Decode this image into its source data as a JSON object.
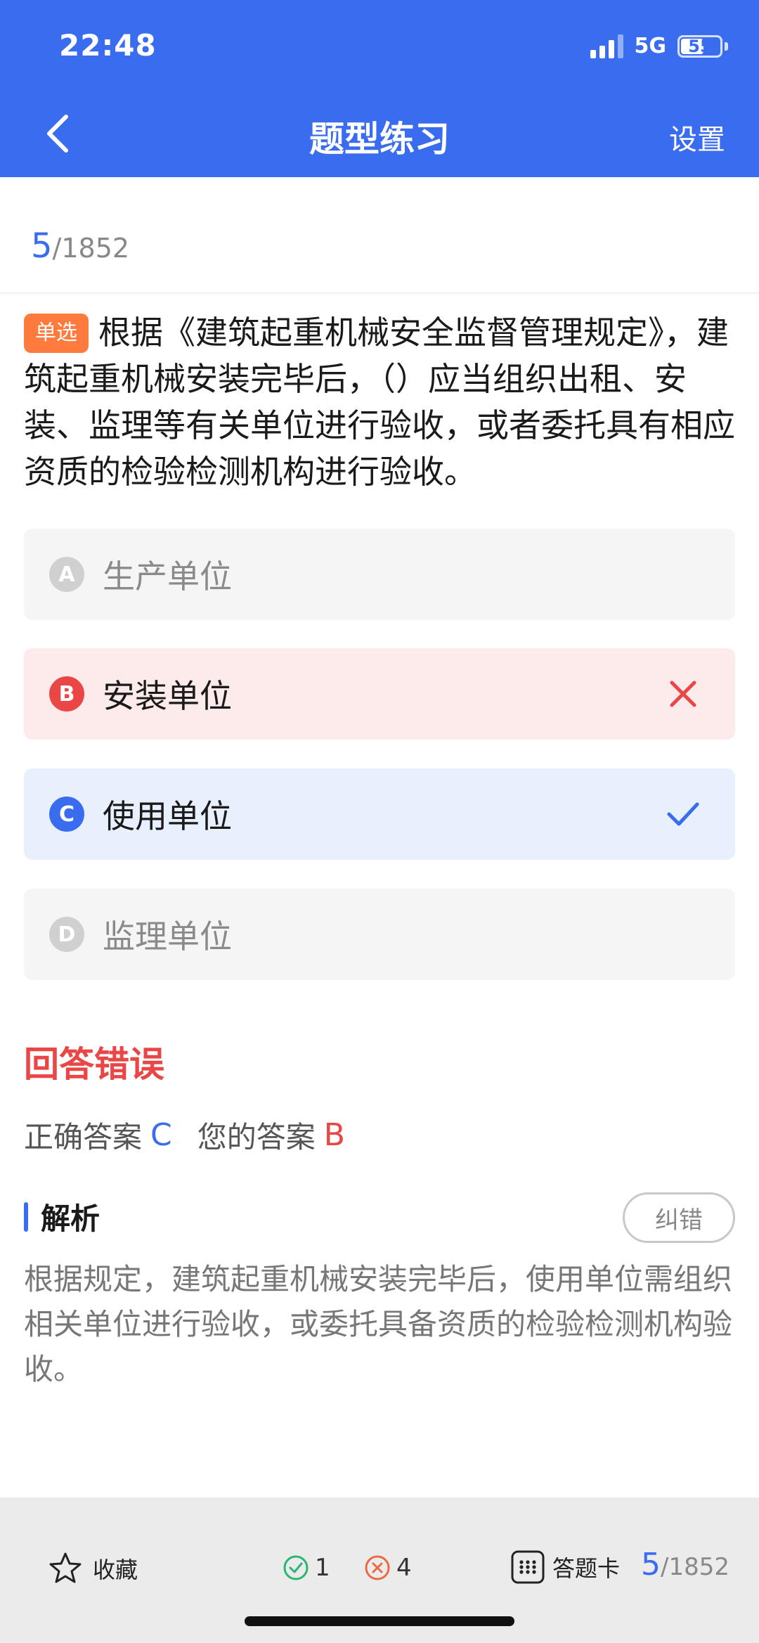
{
  "status_bar": {
    "time": "22:48",
    "network": "5G",
    "battery": "55"
  },
  "nav": {
    "title": "题型练习",
    "settings_label": "设置"
  },
  "progress": {
    "current": "5",
    "total": "/1852"
  },
  "question": {
    "type_label": "单选",
    "text": "根据《建筑起重机械安全监督管理规定》，建筑起重机械安装完毕后，（）应当组织出租、安装、监理等有关单位进行验收，或者委托具有相应资质的检验检测机构进行验收。"
  },
  "options": [
    {
      "letter": "A",
      "text": "生产单位",
      "state": "neutral"
    },
    {
      "letter": "B",
      "text": "安装单位",
      "state": "wrong"
    },
    {
      "letter": "C",
      "text": "使用单位",
      "state": "correct"
    },
    {
      "letter": "D",
      "text": "监理单位",
      "state": "neutral"
    }
  ],
  "result": {
    "title": "回答错误",
    "correct_label": "正确答案",
    "correct_value": "C",
    "yours_label": "您的答案",
    "yours_value": "B"
  },
  "analysis": {
    "label": "解析",
    "report_label": "纠错",
    "text": "根据规定，建筑起重机械安装完毕后，使用单位需组织相关单位进行验收，或委托具备资质的检验检测机构验收。"
  },
  "bottom": {
    "favorite_label": "收藏",
    "correct_count": "1",
    "wrong_count": "4",
    "answer_card_label": "答题卡",
    "current": "5",
    "total": "/1852"
  },
  "colors": {
    "primary": "#3A6CF0",
    "error": "#EB4646",
    "tag": "#FF7A3D",
    "success": "#2BB673"
  }
}
